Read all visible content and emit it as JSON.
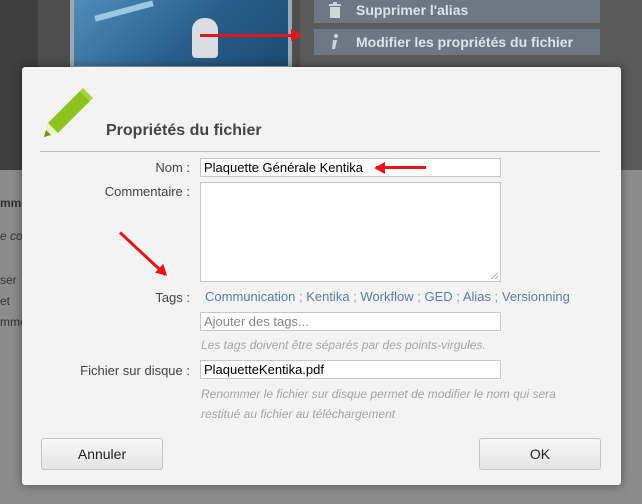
{
  "background": {
    "menu": [
      {
        "icon": "trash-icon",
        "label": "Supprimer l'alias"
      },
      {
        "icon": "info-icon",
        "label": "Modifier les propriétés du fichier"
      }
    ],
    "fragments": [
      "mme",
      "e co",
      "ser",
      "et",
      "mme"
    ]
  },
  "dialog": {
    "title": "Propriétés du fichier",
    "name_label": "Nom :",
    "name_value": "Plaquette Générale Kentika",
    "comment_label": "Commentaire :",
    "comment_value": "",
    "tags_label": "Tags :",
    "tags": [
      "Communication",
      "Kentika",
      "Workflow",
      "GED",
      "Alias",
      "Versionning"
    ],
    "tags_separator": ";",
    "tags_placeholder": "Ajouter des tags...",
    "tags_hint": "Les tags doivent être séparés par des points-virgules.",
    "file_label": "Fichier sur disque :",
    "file_value": "PlaquetteKentika.pdf",
    "file_hint_line1": "Renommer le fichier sur disque permet de modifier le nom qui sera",
    "file_hint_line2": "restitué au fichier au téléchargement",
    "cancel_label": "Annuler",
    "ok_label": "OK"
  },
  "colors": {
    "annotation_arrow": "#e8141b",
    "pencil_icon": "#8dc21f",
    "tag_link": "#5d7ca3"
  }
}
